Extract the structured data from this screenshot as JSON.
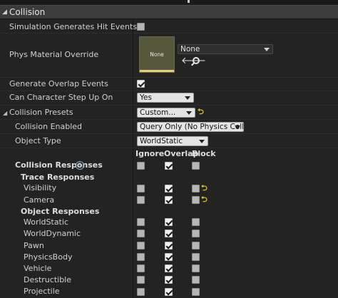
{
  "section": {
    "title": "Collision"
  },
  "rows": {
    "sim_hit_events": {
      "label": "Simulation Generates Hit Events",
      "checked": false
    },
    "phys_material": {
      "label": "Phys Material Override",
      "thumb_text": "None",
      "value": "None"
    },
    "overlap_events": {
      "label": "Generate Overlap Events",
      "checked": true
    },
    "step_up": {
      "label": "Can Character Step Up On",
      "value": "Yes"
    },
    "presets": {
      "label": "Collision Presets",
      "value": "Custom..."
    },
    "enabled": {
      "label": "Collision Enabled",
      "value": "Query Only (No Physics Collision)"
    },
    "object_type": {
      "label": "Object Type",
      "value": "WorldStatic"
    }
  },
  "responses": {
    "columns": {
      "ignore": "Ignore",
      "overlap": "Overlap",
      "block": "Block"
    },
    "title": "Collision Responses",
    "trace_title": "Trace Responses",
    "object_title": "Object Responses",
    "trace": [
      {
        "label": "Visibility",
        "ignore": false,
        "overlap": true,
        "block": false,
        "reset": true
      },
      {
        "label": "Camera",
        "ignore": false,
        "overlap": true,
        "block": false,
        "reset": true
      }
    ],
    "objects": [
      {
        "label": "WorldStatic",
        "ignore": false,
        "overlap": true,
        "block": false
      },
      {
        "label": "WorldDynamic",
        "ignore": false,
        "overlap": true,
        "block": false
      },
      {
        "label": "Pawn",
        "ignore": false,
        "overlap": true,
        "block": false
      },
      {
        "label": "PhysicsBody",
        "ignore": false,
        "overlap": true,
        "block": false
      },
      {
        "label": "Vehicle",
        "ignore": false,
        "overlap": true,
        "block": false
      },
      {
        "label": "Destructible",
        "ignore": false,
        "overlap": true,
        "block": false
      },
      {
        "label": "Projectile",
        "ignore": false,
        "overlap": true,
        "block": false
      }
    ]
  },
  "icons": {
    "section_caret": "triangle-down",
    "browse": "arrow-left",
    "search": "magnifier",
    "reset": "reset-arrow",
    "help": "question-circle"
  }
}
